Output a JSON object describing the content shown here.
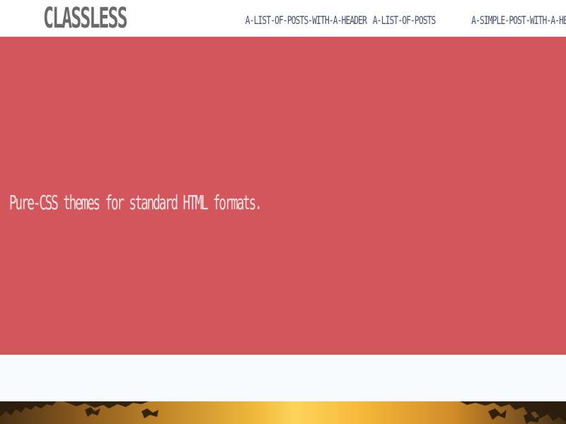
{
  "site": {
    "logo": "CLASSLESS"
  },
  "nav": {
    "items": [
      {
        "label": "A-LIST-OF-POSTS-WITH-A-HEADER"
      },
      {
        "label": "A-LIST-OF-POSTS"
      },
      {
        "label": "A-SIMPLE-POST-WITH-A-HEADER"
      }
    ]
  },
  "hero": {
    "tagline": "Pure-CSS themes for standard HTML formats.",
    "background_color": "#d3565d"
  },
  "photo": {
    "icon": "sunset-tree-photo"
  }
}
